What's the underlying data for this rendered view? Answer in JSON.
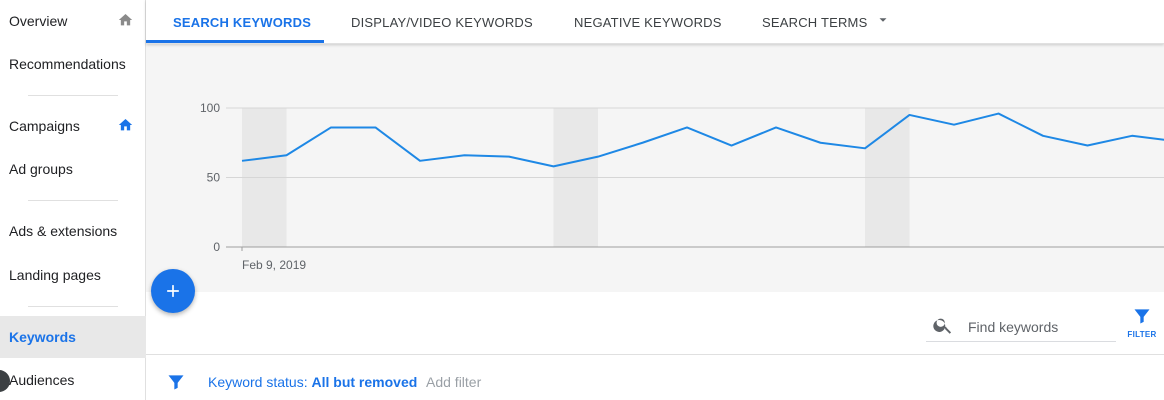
{
  "sidebar": {
    "items": [
      {
        "label": "Overview",
        "home_icon": true,
        "home_color": "#8a8a8a"
      },
      {
        "label": "Recommendations"
      },
      {
        "label": "Campaigns",
        "home_icon": true,
        "home_color": "#1a73e8"
      },
      {
        "label": "Ad groups"
      },
      {
        "label": "Ads & extensions"
      },
      {
        "label": "Landing pages"
      },
      {
        "label": "Keywords",
        "active": true
      },
      {
        "label": "Audiences"
      }
    ]
  },
  "tabs": {
    "items": [
      {
        "label": "SEARCH KEYWORDS",
        "active": true
      },
      {
        "label": "DISPLAY/VIDEO KEYWORDS"
      },
      {
        "label": "NEGATIVE KEYWORDS"
      },
      {
        "label": "SEARCH TERMS"
      }
    ],
    "more_icon": "caret-down-icon"
  },
  "chart_data": {
    "type": "line",
    "x_start_label": "Feb 9, 2019",
    "yticks": [
      0,
      50,
      100
    ],
    "ylim": [
      0,
      100
    ],
    "series": [
      {
        "color": "#1e88e5",
        "values": [
          62,
          66,
          86,
          86,
          62,
          66,
          65,
          58,
          65,
          75,
          86,
          73,
          86,
          75,
          71,
          95,
          88,
          96,
          80,
          73,
          80,
          76
        ]
      }
    ],
    "shaded_weekend_indices": [
      0,
      7,
      14
    ],
    "grid": true
  },
  "fab": {
    "icon": "plus-icon"
  },
  "search": {
    "placeholder": "Find keywords",
    "value": ""
  },
  "filter_button": {
    "label": "FILTER"
  },
  "filter_bar": {
    "status_prefix": "Keyword status: ",
    "status_value": "All but removed",
    "add_filter": "Add filter"
  },
  "colors": {
    "accent": "#1a73e8",
    "line": "#1e88e5",
    "chart_bg": "#f5f5f5"
  }
}
